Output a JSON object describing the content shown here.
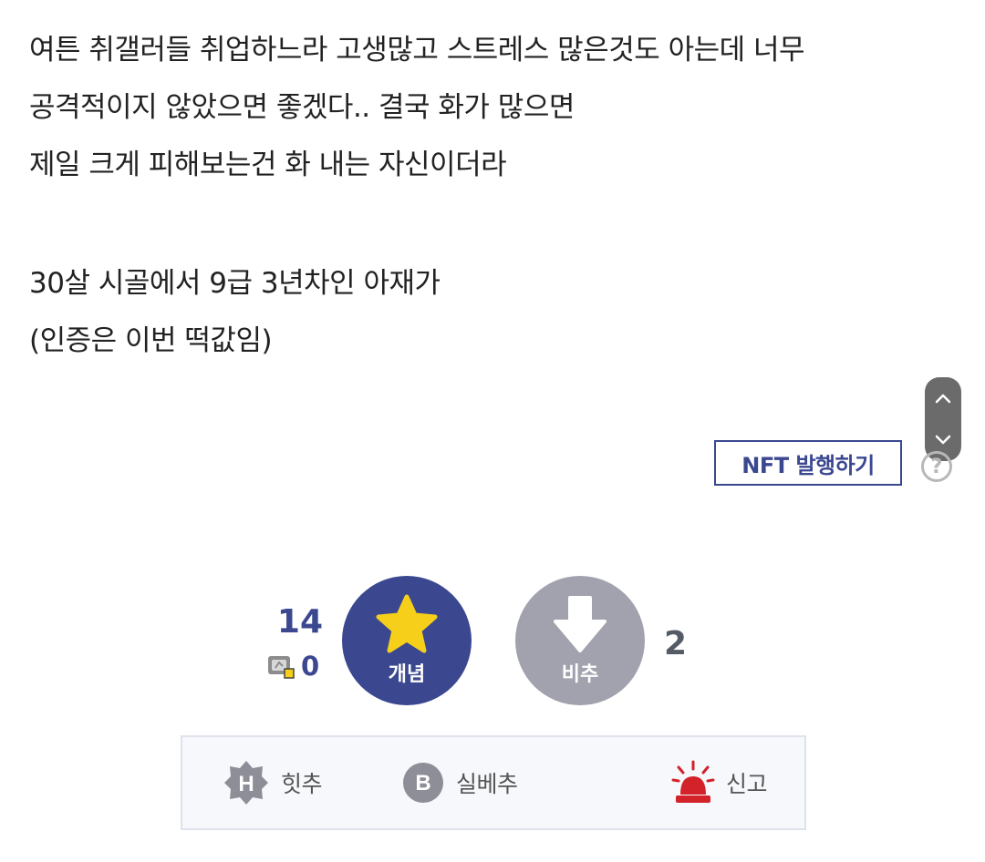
{
  "post": {
    "lines": [
      "여튼 취갤러들 취업하느라 고생많고 스트레스 많은것도 아는데 너무",
      "공격적이지 않았으면 좋겠다.. 결국 화가 많으면",
      "제일 크게 피해보는건 화 내는 자신이더라",
      "",
      "30살 시골에서 9급 3년차인 아재가",
      "(인증은 이번 떡값임)"
    ]
  },
  "nft": {
    "button_label": "NFT 발행하기",
    "help_symbol": "?"
  },
  "votes": {
    "up_count": "14",
    "fix_count": "0",
    "up_label": "개념",
    "down_label": "비추",
    "down_count": "2"
  },
  "actions": {
    "hit_label": "힛추",
    "best_label": "실베추",
    "report_label": "신고"
  },
  "colors": {
    "accent": "#3b4890",
    "star": "#f5cf1a",
    "downvote": "#a2a2ae",
    "report": "#d3222a",
    "action_icon": "#8e8e99"
  },
  "icons": {
    "scroll_up": "chevron-up-icon",
    "scroll_down": "chevron-down-icon",
    "help": "question-circle-icon",
    "fix": "fix-badge-icon",
    "upvote": "star-icon",
    "downvote": "arrow-down-icon",
    "hit": "hit-badge-icon",
    "best": "best-badge-icon",
    "report": "siren-icon"
  }
}
